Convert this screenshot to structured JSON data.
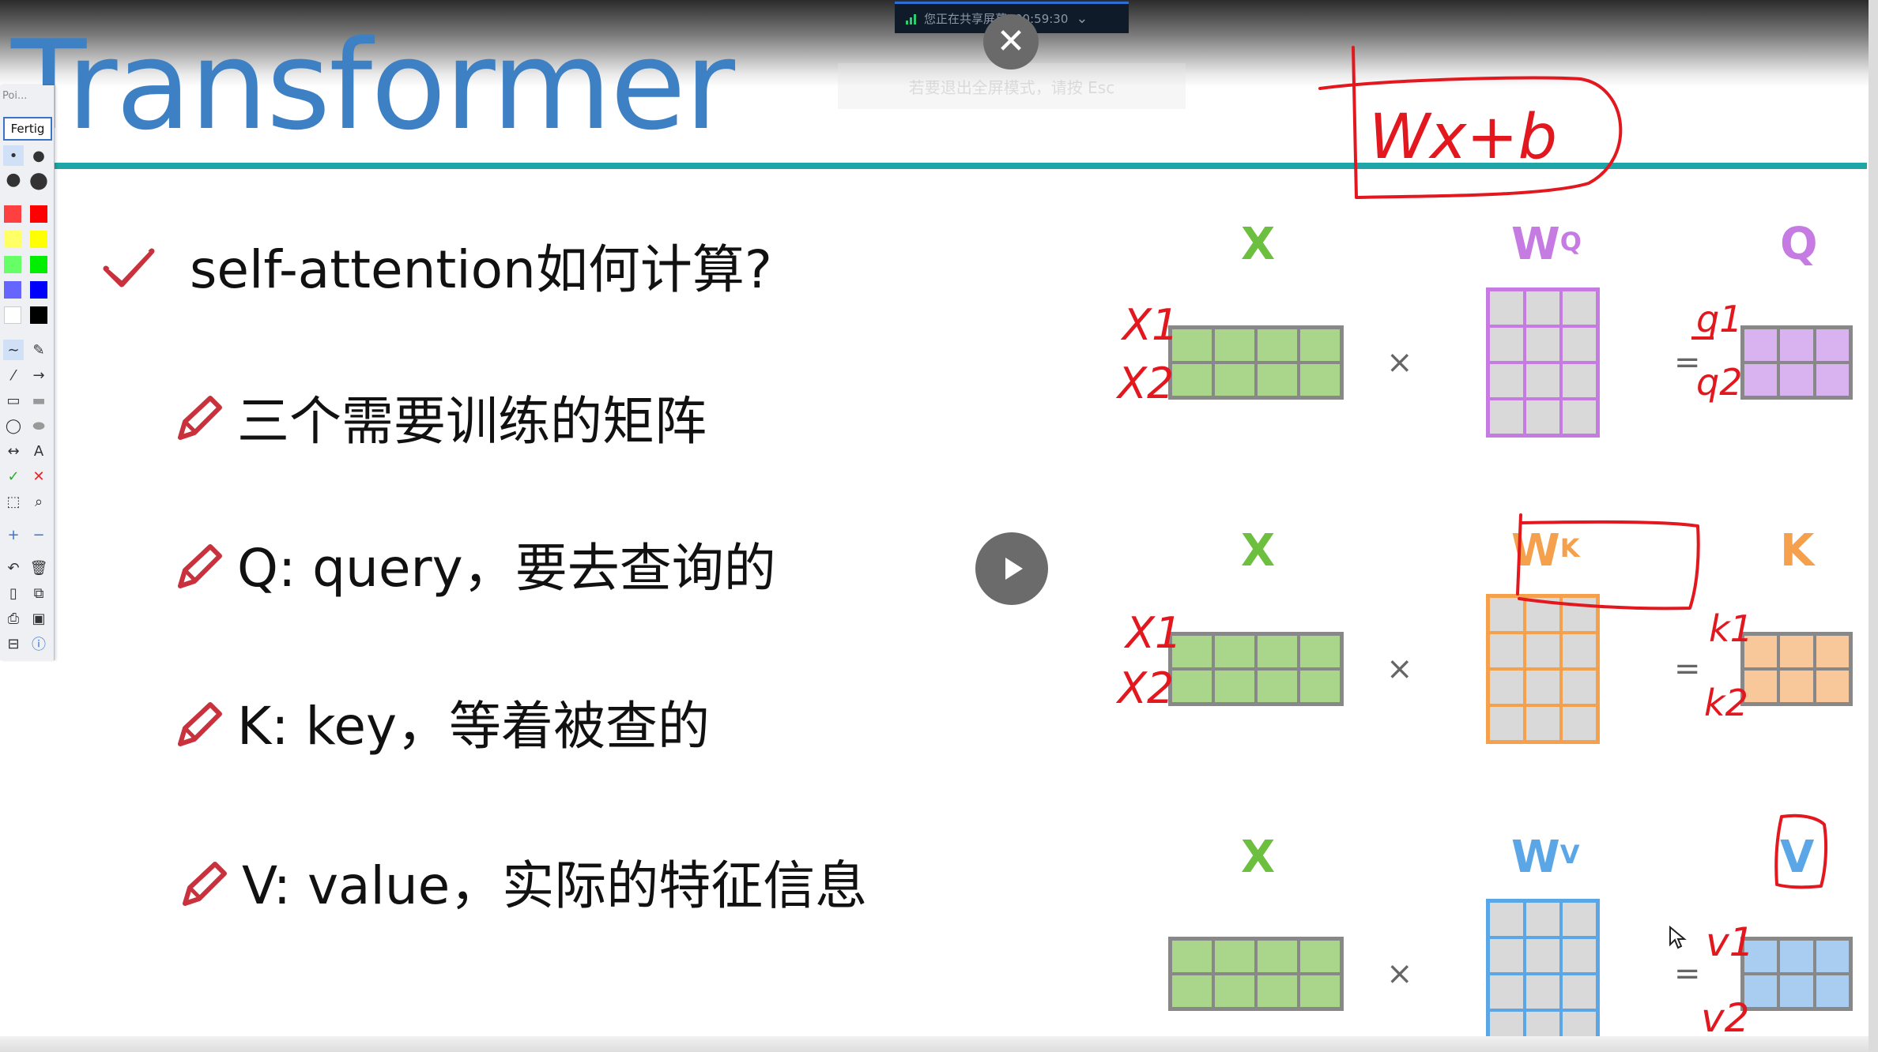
{
  "slide": {
    "title": "Transformer",
    "accent_color": "#1ea5a8",
    "title_color": "#3d80c4"
  },
  "share_indicator": {
    "status": "您正在共享屏幕",
    "timer": "00:59:30",
    "hint": "若要退出全屏模式，请按 Esc"
  },
  "toolbar": {
    "title": "Poi...",
    "done_label": "Fertig",
    "text_tool": "A",
    "colors": [
      "#ff4040",
      "#ff0000",
      "#ffff66",
      "#ffff00",
      "#66ff66",
      "#00ee00",
      "#6666ff",
      "#0000ff",
      "#ffffff",
      "#000000"
    ]
  },
  "bullets": [
    {
      "icon": "check-icon",
      "text": "self-attention如何计算?"
    },
    {
      "icon": "pencil-icon",
      "text": "三个需要训练的矩阵"
    },
    {
      "icon": "pencil-icon",
      "text": "Q: query，要去查询的"
    },
    {
      "icon": "pencil-icon",
      "text": "K: key，等着被查的"
    },
    {
      "icon": "pencil-icon",
      "text": "V: value，实际的特征信息"
    }
  ],
  "matrices": {
    "rows": [
      {
        "input": "X",
        "weight": "W",
        "weight_sup": "Q",
        "output": "Q",
        "weight_color": "#d9b3f0",
        "weight_border": "#c57be2",
        "output_color": "#d9b3f0"
      },
      {
        "input": "X",
        "weight": "W",
        "weight_sup": "K",
        "output": "K",
        "weight_color": "#f8c89a",
        "weight_border": "#f5a04c",
        "output_color": "#f8c89a"
      },
      {
        "input": "X",
        "weight": "W",
        "weight_sup": "V",
        "output": "V",
        "weight_color": "#a9cdf0",
        "weight_border": "#5aa6e6",
        "output_color": "#a9cdf0"
      }
    ],
    "input_color": "#a9d68a",
    "times": "×",
    "equals": "="
  },
  "annotations": {
    "color": "#e3181f",
    "formula": "Wx+b",
    "row_labels": [
      [
        "X1",
        "X2"
      ],
      [
        "X1",
        "X2"
      ],
      [
        "",
        ""
      ]
    ],
    "q_labels": [
      "q1",
      "q2"
    ],
    "k_labels": [
      "k1",
      "k2"
    ],
    "v_labels": [
      "v1",
      "v2"
    ]
  }
}
